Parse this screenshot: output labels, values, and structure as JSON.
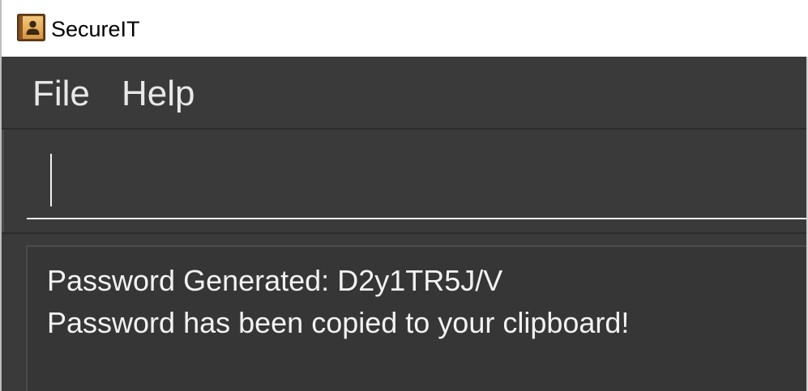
{
  "window": {
    "title": "SecureIT",
    "icon": "address-book-icon"
  },
  "menu": {
    "items": [
      {
        "label": "File"
      },
      {
        "label": "Help"
      }
    ]
  },
  "command_box": {
    "value": ""
  },
  "result_display": {
    "lines": [
      "Password Generated: D2y1TR5J/V",
      "Password has been copied to your clipboard!"
    ]
  },
  "colors": {
    "title_bar_bg": "#ffffff",
    "title_text": "#000000",
    "app_bg": "#3a3a3a",
    "result_bg": "#363636",
    "menu_text": "#e8e8e8",
    "text": "#f2f2f2",
    "divider": "#2c2c2c"
  }
}
